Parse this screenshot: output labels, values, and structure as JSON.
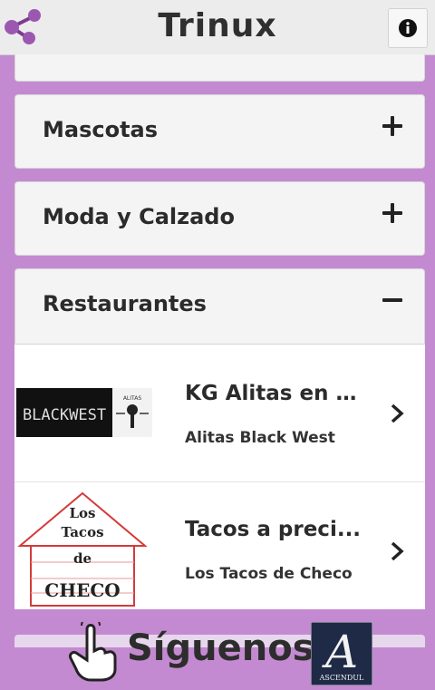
{
  "app": {
    "title": "Trinux"
  },
  "header": {
    "share_icon": "share-icon",
    "info_icon": "info-icon"
  },
  "categories": [
    {
      "label": "Mascotas",
      "state": "collapsed"
    },
    {
      "label": "Moda y Calzado",
      "state": "collapsed"
    },
    {
      "label": "Restaurantes",
      "state": "expanded"
    }
  ],
  "restaurants": [
    {
      "title": "KG Alitas en $...",
      "subtitle": "Alitas Black West",
      "logo_text": "BLACKWEST",
      "logo_badge": "ALITAS"
    },
    {
      "title": "Tacos a preci...",
      "subtitle": "Los Tacos de Checo",
      "logo_lines": [
        "Los",
        "Tacos",
        "de",
        "CHECO"
      ]
    }
  ],
  "footer": {
    "follow_label": "Síguenos",
    "brand_letter": "A",
    "brand_name": "ASCENDUL"
  },
  "colors": {
    "background": "#c48ad1",
    "card": "#f4f4f4",
    "text": "#2b2b2b"
  }
}
